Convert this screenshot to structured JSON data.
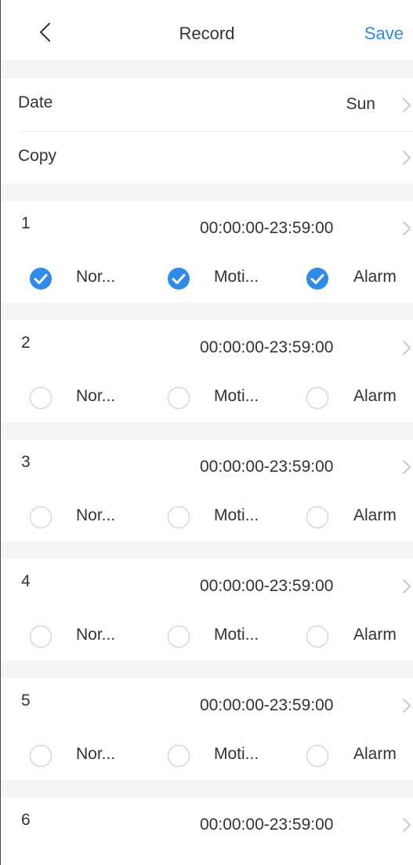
{
  "header": {
    "title": "Record",
    "save_label": "Save",
    "back_icon": "back-chevron-icon"
  },
  "settings": {
    "date_label": "Date",
    "date_value": "Sun",
    "copy_label": "Copy"
  },
  "option_labels": {
    "normal": "Nor...",
    "motion": "Moti...",
    "alarm": "Alarm"
  },
  "schedules": [
    {
      "num": "1",
      "time": "00:00:00-23:59:00",
      "normal": true,
      "motion": true,
      "alarm": true
    },
    {
      "num": "2",
      "time": "00:00:00-23:59:00",
      "normal": false,
      "motion": false,
      "alarm": false
    },
    {
      "num": "3",
      "time": "00:00:00-23:59:00",
      "normal": false,
      "motion": false,
      "alarm": false
    },
    {
      "num": "4",
      "time": "00:00:00-23:59:00",
      "normal": false,
      "motion": false,
      "alarm": false
    },
    {
      "num": "5",
      "time": "00:00:00-23:59:00",
      "normal": false,
      "motion": false,
      "alarm": false
    },
    {
      "num": "6",
      "time": "00:00:00-23:59:00"
    }
  ],
  "colors": {
    "accent": "#2f8ae8",
    "unchecked_border": "#d8d8d8",
    "background_gap": "#f5f5f5",
    "text": "#333333"
  }
}
